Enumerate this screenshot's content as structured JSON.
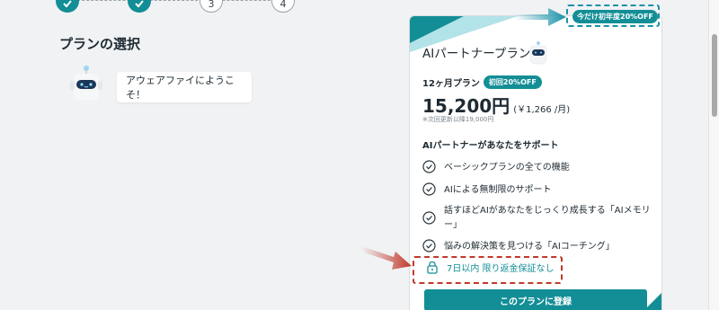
{
  "stepper": {
    "steps": [
      {
        "label": "",
        "state": "done"
      },
      {
        "label": "",
        "state": "done"
      },
      {
        "label": "3",
        "state": "todo"
      },
      {
        "label": "4",
        "state": "todo"
      }
    ]
  },
  "page": {
    "title": "プランの選択",
    "greeting": "アウェアファイにようこそ！"
  },
  "card": {
    "plan_name": "AIパートナープラン",
    "period": "12ヶ月プラン",
    "badge": "初回20%OFF",
    "price": "15,200円",
    "price_per_month": "(￥1,266 /月)",
    "renewal_note": "※次回更新以降19,000円",
    "support_title": "AIパートナーがあなたをサポート",
    "features": [
      "ベーシックプランの全ての機能",
      "AIによる無制限のサポート",
      "話すほどAIがあなたをじっくり成長する「AIメモリー」",
      "悩みの解決策を見つける「AIコーチング」"
    ],
    "guarantee": "7日以内 限り返金保証なし",
    "register_button": "このプランに登録"
  },
  "annotations": {
    "top_badge": "今だけ初年度20%OFF"
  },
  "colors": {
    "accent": "#138e96",
    "highlight_blue": "#1b92a8",
    "highlight_red": "#c0392b"
  },
  "icons": {
    "check": "check-circle-icon",
    "lock": "lock-icon",
    "mascot": "robot-mascot-icon"
  }
}
